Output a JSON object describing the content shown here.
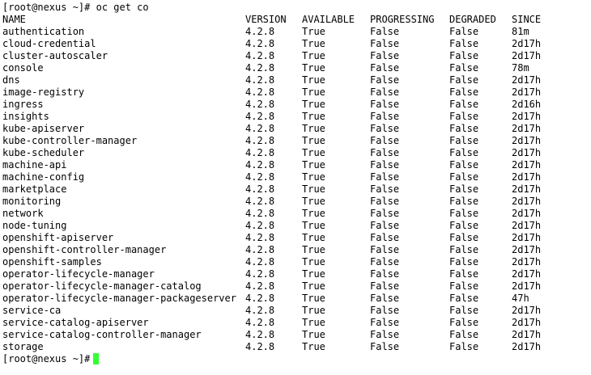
{
  "terminal": {
    "command_prompt": "[root@nexus ~]# oc get co",
    "final_prompt": "[root@nexus ~]#",
    "cursor_color": "#33ff33",
    "headers": {
      "name": "NAME",
      "version": "VERSION",
      "available": "AVAILABLE",
      "progressing": "PROGRESSING",
      "degraded": "DEGRADED",
      "since": "SINCE"
    },
    "rows": [
      {
        "name": "authentication",
        "version": "4.2.8",
        "available": "True",
        "progressing": "False",
        "degraded": "False",
        "since": "81m"
      },
      {
        "name": "cloud-credential",
        "version": "4.2.8",
        "available": "True",
        "progressing": "False",
        "degraded": "False",
        "since": "2d17h"
      },
      {
        "name": "cluster-autoscaler",
        "version": "4.2.8",
        "available": "True",
        "progressing": "False",
        "degraded": "False",
        "since": "2d17h"
      },
      {
        "name": "console",
        "version": "4.2.8",
        "available": "True",
        "progressing": "False",
        "degraded": "False",
        "since": "78m"
      },
      {
        "name": "dns",
        "version": "4.2.8",
        "available": "True",
        "progressing": "False",
        "degraded": "False",
        "since": "2d17h"
      },
      {
        "name": "image-registry",
        "version": "4.2.8",
        "available": "True",
        "progressing": "False",
        "degraded": "False",
        "since": "2d17h"
      },
      {
        "name": "ingress",
        "version": "4.2.8",
        "available": "True",
        "progressing": "False",
        "degraded": "False",
        "since": "2d16h"
      },
      {
        "name": "insights",
        "version": "4.2.8",
        "available": "True",
        "progressing": "False",
        "degraded": "False",
        "since": "2d17h"
      },
      {
        "name": "kube-apiserver",
        "version": "4.2.8",
        "available": "True",
        "progressing": "False",
        "degraded": "False",
        "since": "2d17h"
      },
      {
        "name": "kube-controller-manager",
        "version": "4.2.8",
        "available": "True",
        "progressing": "False",
        "degraded": "False",
        "since": "2d17h"
      },
      {
        "name": "kube-scheduler",
        "version": "4.2.8",
        "available": "True",
        "progressing": "False",
        "degraded": "False",
        "since": "2d17h"
      },
      {
        "name": "machine-api",
        "version": "4.2.8",
        "available": "True",
        "progressing": "False",
        "degraded": "False",
        "since": "2d17h"
      },
      {
        "name": "machine-config",
        "version": "4.2.8",
        "available": "True",
        "progressing": "False",
        "degraded": "False",
        "since": "2d17h"
      },
      {
        "name": "marketplace",
        "version": "4.2.8",
        "available": "True",
        "progressing": "False",
        "degraded": "False",
        "since": "2d17h"
      },
      {
        "name": "monitoring",
        "version": "4.2.8",
        "available": "True",
        "progressing": "False",
        "degraded": "False",
        "since": "2d17h"
      },
      {
        "name": "network",
        "version": "4.2.8",
        "available": "True",
        "progressing": "False",
        "degraded": "False",
        "since": "2d17h"
      },
      {
        "name": "node-tuning",
        "version": "4.2.8",
        "available": "True",
        "progressing": "False",
        "degraded": "False",
        "since": "2d17h"
      },
      {
        "name": "openshift-apiserver",
        "version": "4.2.8",
        "available": "True",
        "progressing": "False",
        "degraded": "False",
        "since": "2d17h"
      },
      {
        "name": "openshift-controller-manager",
        "version": "4.2.8",
        "available": "True",
        "progressing": "False",
        "degraded": "False",
        "since": "2d17h"
      },
      {
        "name": "openshift-samples",
        "version": "4.2.8",
        "available": "True",
        "progressing": "False",
        "degraded": "False",
        "since": "2d17h"
      },
      {
        "name": "operator-lifecycle-manager",
        "version": "4.2.8",
        "available": "True",
        "progressing": "False",
        "degraded": "False",
        "since": "2d17h"
      },
      {
        "name": "operator-lifecycle-manager-catalog",
        "version": "4.2.8",
        "available": "True",
        "progressing": "False",
        "degraded": "False",
        "since": "2d17h"
      },
      {
        "name": "operator-lifecycle-manager-packageserver",
        "version": "4.2.8",
        "available": "True",
        "progressing": "False",
        "degraded": "False",
        "since": "47h"
      },
      {
        "name": "service-ca",
        "version": "4.2.8",
        "available": "True",
        "progressing": "False",
        "degraded": "False",
        "since": "2d17h"
      },
      {
        "name": "service-catalog-apiserver",
        "version": "4.2.8",
        "available": "True",
        "progressing": "False",
        "degraded": "False",
        "since": "2d17h"
      },
      {
        "name": "service-catalog-controller-manager",
        "version": "4.2.8",
        "available": "True",
        "progressing": "False",
        "degraded": "False",
        "since": "2d17h"
      },
      {
        "name": "storage",
        "version": "4.2.8",
        "available": "True",
        "progressing": "False",
        "degraded": "False",
        "since": "2d17h"
      }
    ]
  }
}
